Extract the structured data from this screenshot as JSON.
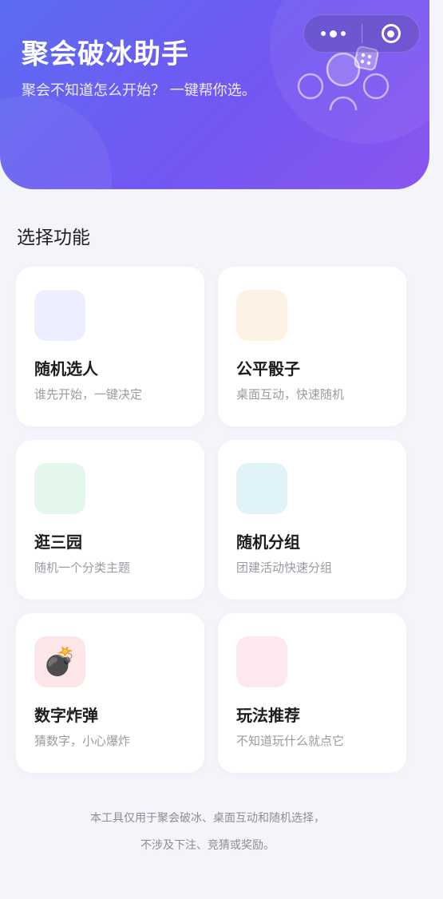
{
  "header": {
    "title": "聚会破冰助手",
    "subtitle": "聚会不知道怎么开始？ 一键帮你选。"
  },
  "capsule": {
    "more_icon": "more-dots-icon",
    "close_icon": "target-circle-icon"
  },
  "section": {
    "title": "选择功能"
  },
  "cards": [
    {
      "title": "随机选人",
      "desc": "谁先开始，一键决定",
      "icon_color": "#ecedfe",
      "icon": ""
    },
    {
      "title": "公平骰子",
      "desc": "桌面互动，快速随机",
      "icon_color": "#fef2e6",
      "icon": ""
    },
    {
      "title": "逛三园",
      "desc": "随机一个分类主题",
      "icon_color": "#e3f7ea",
      "icon": ""
    },
    {
      "title": "随机分组",
      "desc": "团建活动快速分组",
      "icon_color": "#dff3f9",
      "icon": ""
    },
    {
      "title": "数字炸弹",
      "desc": "猜数字，小心爆炸",
      "icon_color": "#fde6e7",
      "icon": "💣"
    },
    {
      "title": "玩法推荐",
      "desc": "不知道玩什么就点它",
      "icon_color": "#fde7f1",
      "icon": ""
    }
  ],
  "footer": {
    "line1": "本工具仅用于聚会破冰、桌面互动和随机选择，",
    "line2": "不涉及下注、竞猜或奖励。"
  },
  "colors": {
    "gradient_start": "#5b6cf1",
    "gradient_end": "#8a55f0",
    "background": "#f4f5fa"
  }
}
